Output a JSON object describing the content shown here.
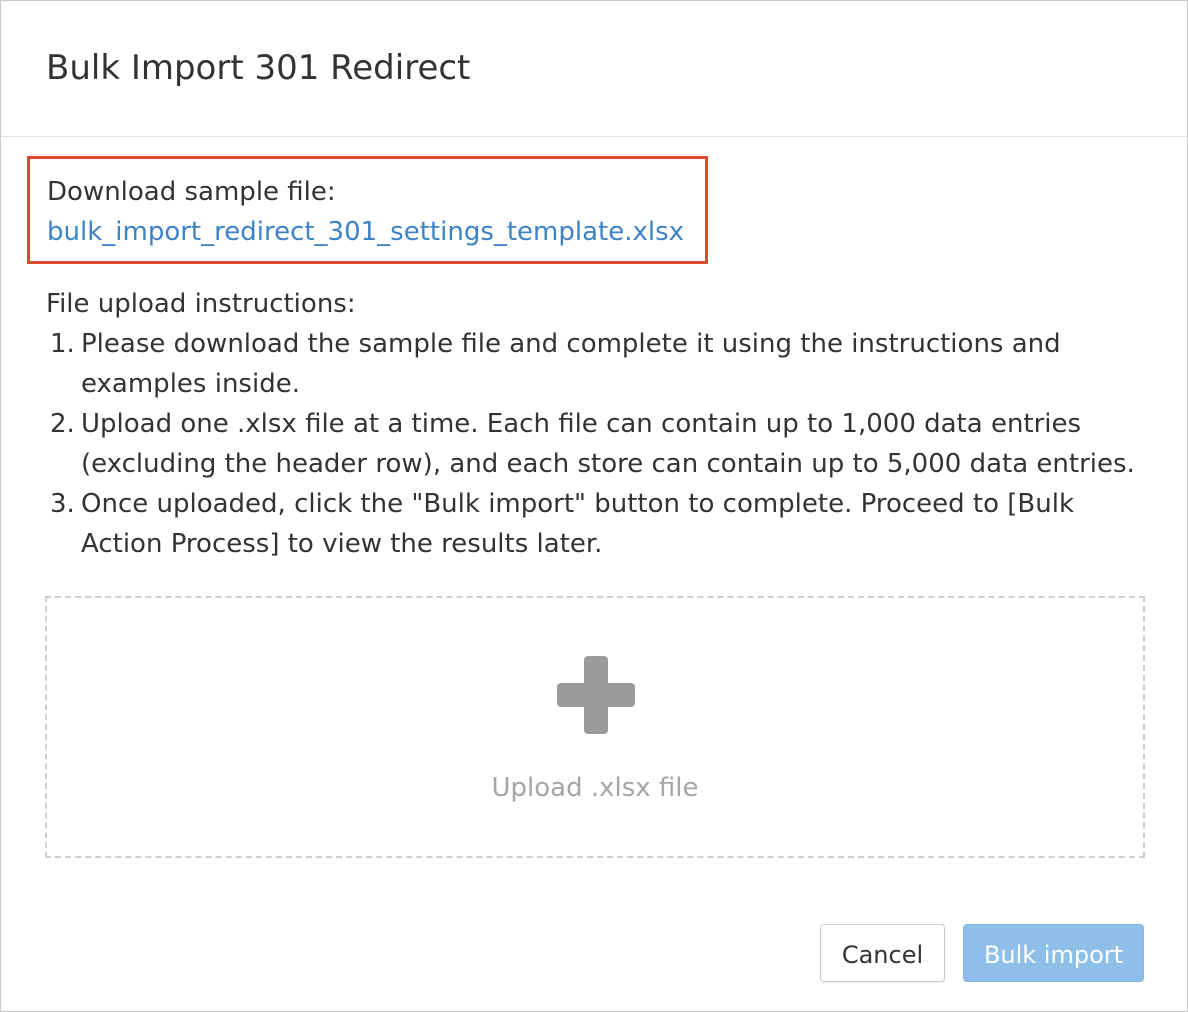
{
  "modal": {
    "title": "Bulk Import 301 Redirect"
  },
  "sample": {
    "label": "Download sample file:",
    "link_text": "bulk_import_redirect_301_settings_template.xlsx",
    "highlight_color": "#e0492f",
    "link_color": "#3d83c6"
  },
  "instructions": {
    "title": "File upload instructions:",
    "items": [
      {
        "num": "1.",
        "text": "Please download the sample file and complete it using the instructions and examples inside."
      },
      {
        "num": "2.",
        "text": "Upload one .xlsx file at a time. Each file can contain up to 1,000 data entries (excluding the header row), and each store can contain up to 5,000 data entries."
      },
      {
        "num": "3.",
        "text": "Once uploaded, click the \"Bulk import\" button to complete. Proceed to [Bulk Action Process] to view the results later."
      }
    ]
  },
  "dropzone": {
    "icon": "plus-icon",
    "label": "Upload .xlsx file"
  },
  "footer": {
    "cancel_label": "Cancel",
    "submit_label": "Bulk import",
    "submit_color": "#8dbfe9"
  }
}
